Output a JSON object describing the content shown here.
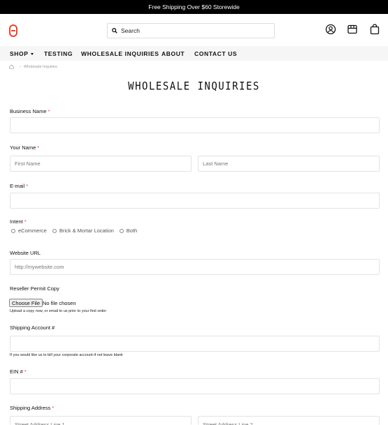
{
  "announcement": "Free Shipping Over $60 Storewide",
  "header": {
    "search_placeholder": "Search",
    "icons": [
      "logo-icon",
      "search-icon",
      "account-icon",
      "store-icon",
      "cart-icon"
    ]
  },
  "nav": {
    "items": [
      "SHOP",
      "TESTING",
      "WHOLESALE INQUIRIES",
      "ABOUT",
      "CONTACT US"
    ]
  },
  "breadcrumb": {
    "separator": "›",
    "current": "Wholesale Inquiries"
  },
  "page_title": "WHOLESALE INQUIRIES",
  "form": {
    "required_marker": "*",
    "business_name": {
      "label": "Business Name",
      "value": ""
    },
    "your_name": {
      "label": "Your Name",
      "first_placeholder": "First Name",
      "last_placeholder": "Last Name"
    },
    "email": {
      "label": "E-mail",
      "value": ""
    },
    "intent": {
      "label": "Intent",
      "options": [
        "eCommerce",
        "Brick & Mortar Location",
        "Both"
      ]
    },
    "website": {
      "label": "Website URL",
      "placeholder": "http://mywebsite.com"
    },
    "reseller": {
      "label": "Reseller Permit Copy",
      "button": "Choose File",
      "status": "No file chosen",
      "help": "Upload a copy now, or email to us prior to your first order"
    },
    "shipping_account": {
      "label": "Shipping Account #",
      "help": "If you would like us to bill your corporate account-if not leave blank"
    },
    "ein": {
      "label": "EIN #"
    },
    "shipping_address": {
      "label": "Shipping Address",
      "line1_placeholder": "Street Address Line 1",
      "line2_placeholder": "Street Address Line 2"
    }
  },
  "colors": {
    "accent": "#e8442e",
    "announcement_bg": "#000000",
    "nav_bg": "#f6f6f6"
  }
}
